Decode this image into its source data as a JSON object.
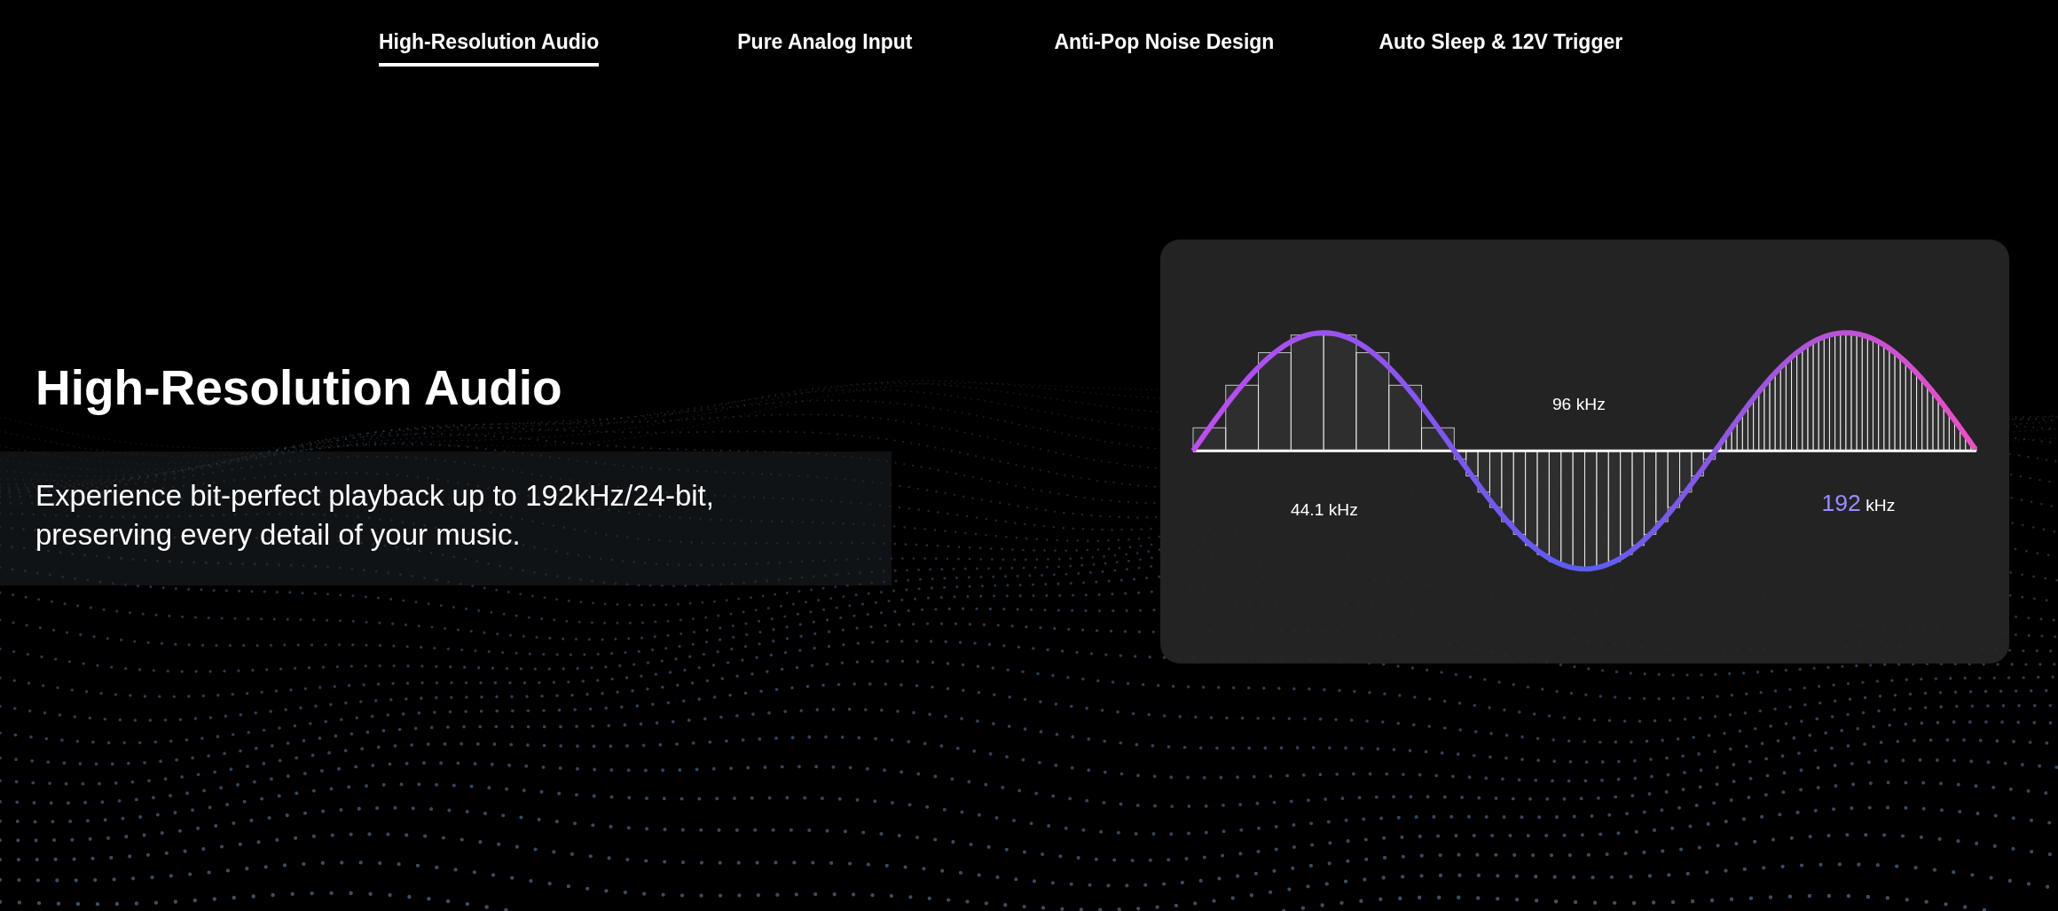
{
  "tabs": [
    {
      "label": "High-Resolution Audio",
      "selected": true
    },
    {
      "label": "Pure Analog Input",
      "selected": false
    },
    {
      "label": "Anti-Pop Noise Design",
      "selected": false
    },
    {
      "label": "Auto Sleep & 12V Trigger",
      "selected": false
    }
  ],
  "feature": {
    "title": "High-Resolution Audio",
    "description": "Experience bit-perfect playback up to 192kHz/24-bit, preserving every detail of your music."
  },
  "diagram": {
    "labels": [
      {
        "kind": "plain",
        "text": "44.1 kHz"
      },
      {
        "kind": "plain",
        "text": "96 kHz"
      },
      {
        "kind": "highlight",
        "number": "192",
        "unit": "kHz"
      }
    ]
  }
}
